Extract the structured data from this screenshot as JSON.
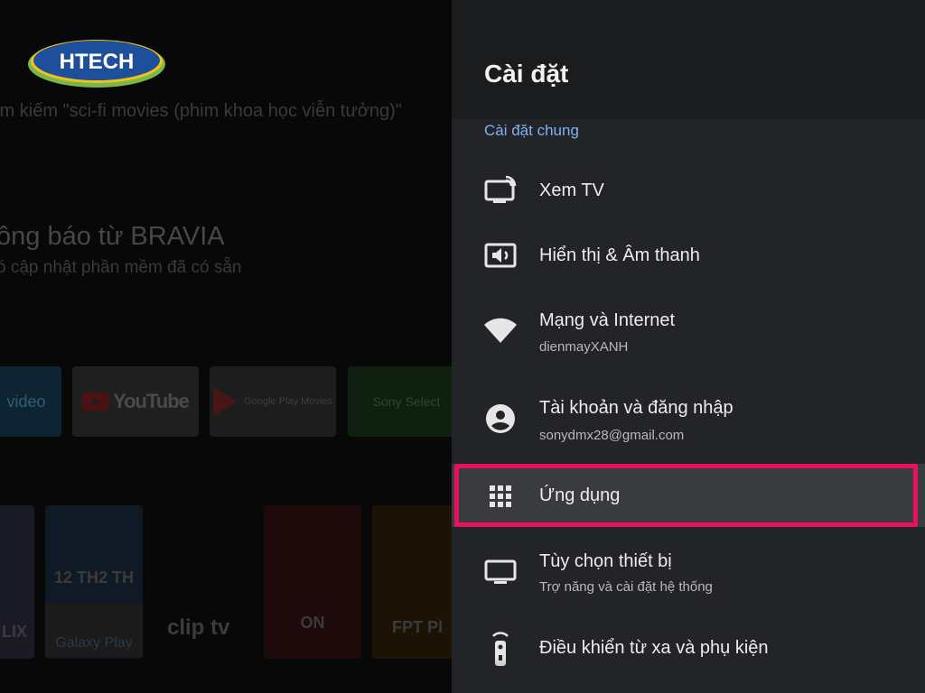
{
  "home": {
    "brand_logo_text": "HTECH",
    "search_hint": "ìm kiếm \"sci-fi movies (phim khoa học viễn tưởng)\"",
    "notification_title": "ông báo từ BRAVIA",
    "notification_subtitle": "ó cập nhật phần mềm đã có sẵn",
    "apps": [
      {
        "label": "video",
        "icon": "prime-video-icon"
      },
      {
        "label": "YouTube",
        "icon": "youtube-icon"
      },
      {
        "label": "Google Play Movies",
        "icon": "google-play-movies-icon"
      },
      {
        "label": "Sony Select",
        "icon": "sony-select-icon"
      }
    ],
    "posters": {
      "p2_caption": "12 TH2 TH",
      "galaxy_label": "Galaxy Play",
      "cliptv_label": "clip tv",
      "p3_caption": "ON",
      "p4_caption": "FPT Pl",
      "p1_caption": "LIX"
    }
  },
  "settings": {
    "title": "Cài đặt",
    "section_label": "Cài đặt chung",
    "items": [
      {
        "title": "Xem TV",
        "subtitle": "",
        "icon": "tv-broadcast-icon"
      },
      {
        "title": "Hiển thị & Âm thanh",
        "subtitle": "",
        "icon": "display-sound-icon"
      },
      {
        "title": "Mạng và Internet",
        "subtitle": "dienmayXANH",
        "icon": "wifi-icon"
      },
      {
        "title": "Tài khoản và đăng nhập",
        "subtitle": "sonydmx28@gmail.com",
        "icon": "account-icon"
      },
      {
        "title": "Ứng dụng",
        "subtitle": "",
        "icon": "apps-grid-icon",
        "selected": true
      },
      {
        "title": "Tùy chọn thiết bị",
        "subtitle": "Trợ năng và cài đặt hệ thống",
        "icon": "monitor-icon"
      },
      {
        "title": "Điều khiển từ xa và phụ kiện",
        "subtitle": "",
        "icon": "remote-icon"
      }
    ],
    "highlight_color": "#e8125c",
    "accent_color": "#7fb2ee"
  }
}
